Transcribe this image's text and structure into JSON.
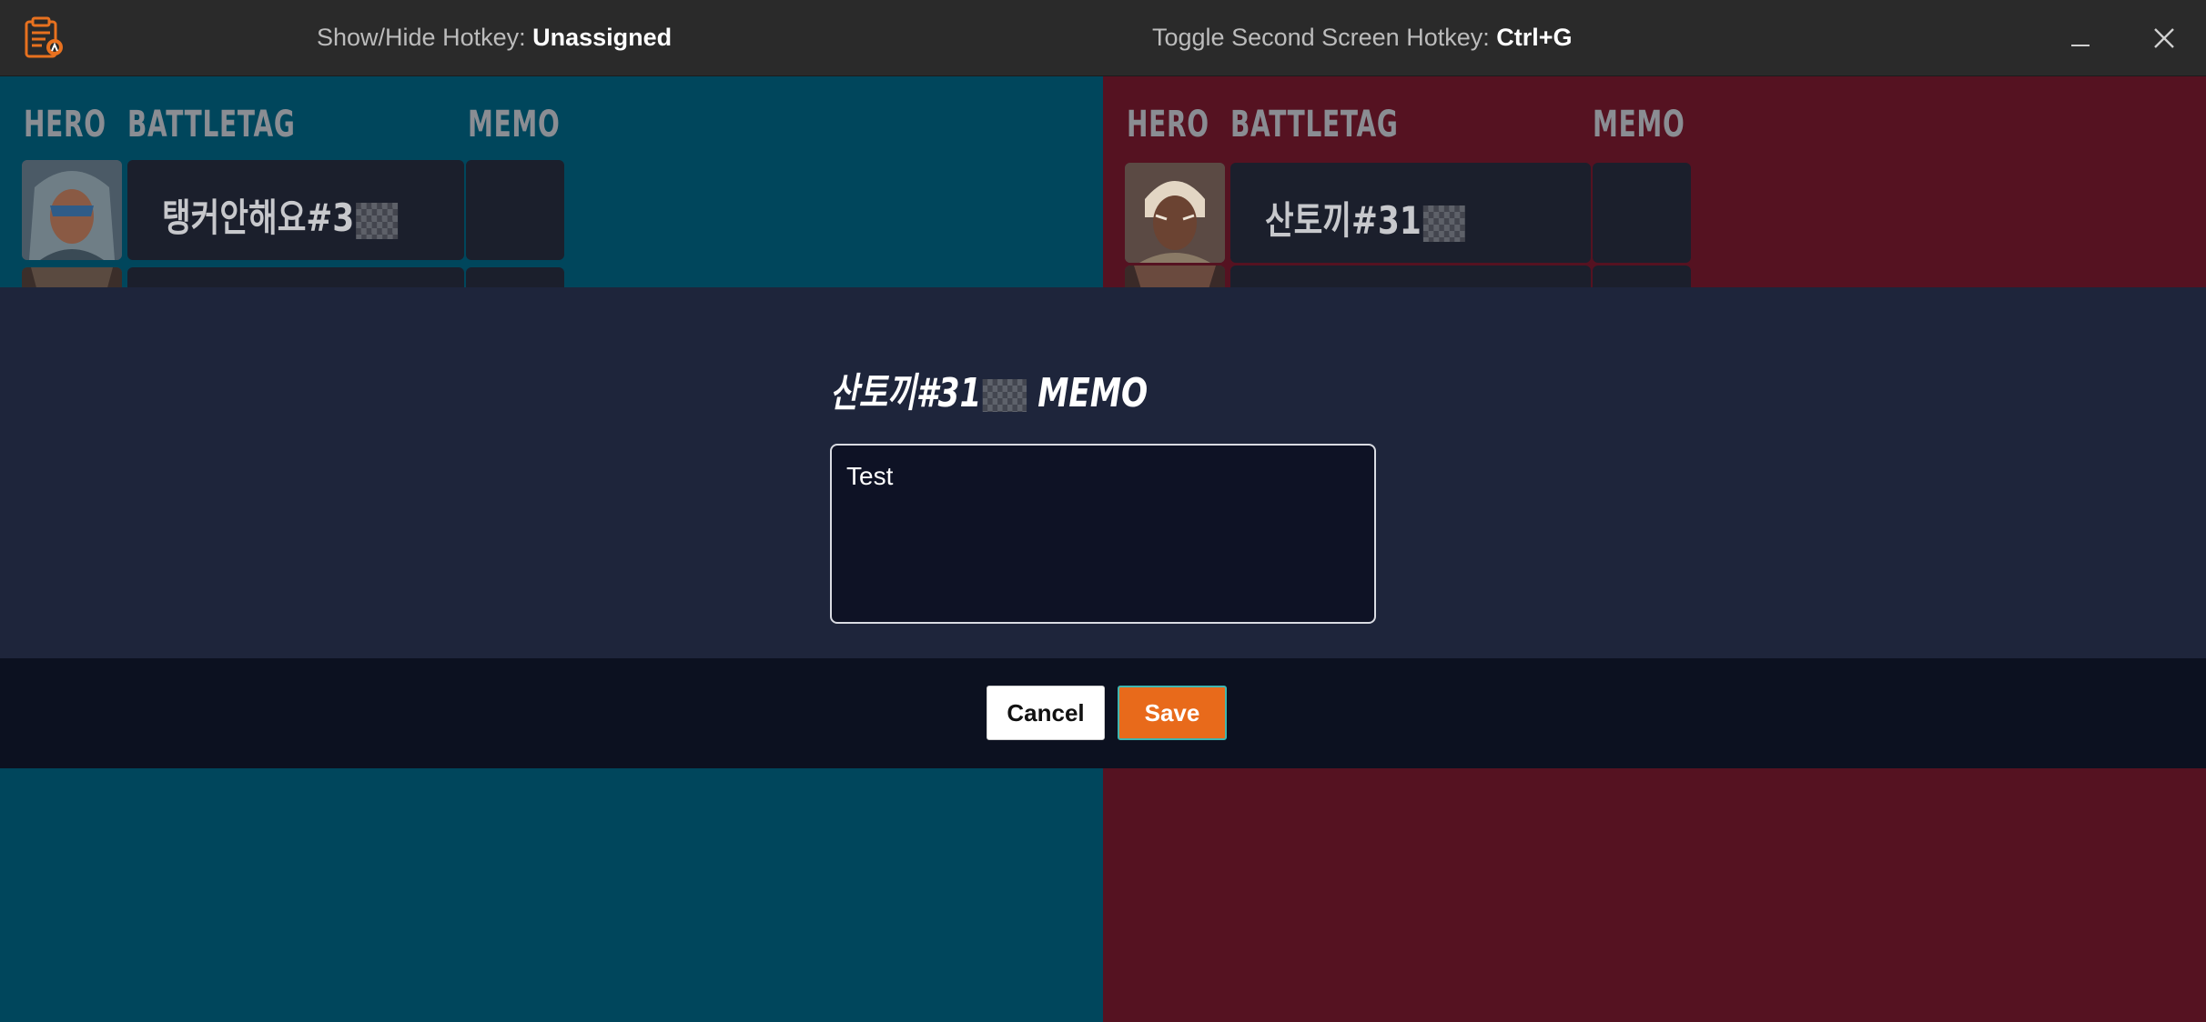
{
  "titlebar": {
    "show_hide_label": "Show/Hide Hotkey: ",
    "show_hide_value": "Unassigned",
    "toggle_label": "Toggle Second Screen Hotkey: ",
    "toggle_value": "Ctrl+G",
    "minimize_icon": "minimize-icon",
    "close_icon": "close-icon",
    "app_icon": "clipboard-overwatch-icon"
  },
  "columns": {
    "hero": "HERO",
    "battletag": "BATTLETAG",
    "memo": "MEMO"
  },
  "teams": {
    "blue": {
      "color": "#00465c",
      "rows": [
        {
          "battletag": "탱커안해요#3"
        },
        {
          "battletag": ""
        }
      ]
    },
    "red": {
      "color": "#551221",
      "rows": [
        {
          "battletag": "산토끼#31"
        },
        {
          "battletag": ""
        }
      ]
    }
  },
  "modal": {
    "title_prefix": "산토끼#31",
    "title_suffix": " MEMO",
    "memo_value": "Test",
    "cancel_label": "Cancel",
    "save_label": "Save",
    "accent": "#e86a1b"
  }
}
